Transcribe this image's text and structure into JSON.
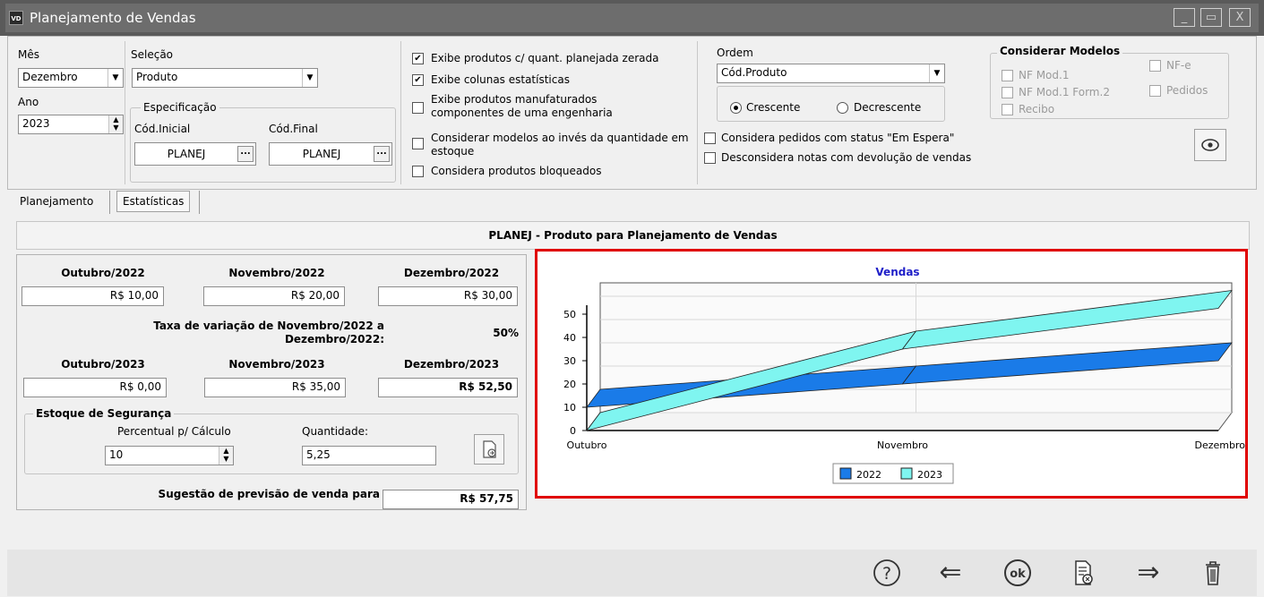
{
  "window": {
    "icon_text": "VD",
    "title": "Planejamento de Vendas",
    "minimize": "_",
    "maximize": "▭",
    "close": "X"
  },
  "filters": {
    "mes_label": "Mês",
    "mes_value": "Dezembro",
    "ano_label": "Ano",
    "ano_value": "2023",
    "selecao_label": "Seleção",
    "selecao_value": "Produto",
    "especificacao_label": "Especificação",
    "cod_inicial_label": "Cód.Inicial",
    "cod_inicial_value": "PLANEJ",
    "cod_final_label": "Cód.Final",
    "cod_final_value": "PLANEJ",
    "dots": "..."
  },
  "options": [
    {
      "label": "Exibe produtos c/ quant. planejada zerada",
      "checked": true
    },
    {
      "label": "Exibe colunas estatísticas",
      "checked": true
    },
    {
      "label": "Exibe produtos manufaturados componentes de uma engenharia",
      "checked": false
    },
    {
      "label": "Considerar modelos ao invés da quantidade em estoque",
      "checked": false
    },
    {
      "label": "Considera produtos bloqueados",
      "checked": false
    }
  ],
  "order": {
    "label": "Ordem",
    "value": "Cód.Produto",
    "asc": "Crescente",
    "desc": "Decrescente",
    "pedidos_espera": "Considera pedidos com status \"Em Espera\"",
    "devolucao": "Desconsidera notas com devolução de vendas"
  },
  "models": {
    "title": "Considerar Modelos",
    "nf_mod1": "NF Mod.1",
    "nf_mod1_form2": "NF Mod.1 Form.2",
    "recibo": "Recibo",
    "nfe": "NF-e",
    "pedidos": "Pedidos"
  },
  "tabs": {
    "planejamento": "Planejamento",
    "estatisticas": "Estatísticas"
  },
  "product_header": "PLANEJ - Produto para Planejamento de Vendas",
  "table": {
    "months_2022": [
      "Outubro/2022",
      "Novembro/2022",
      "Dezembro/2022"
    ],
    "values_2022": [
      "R$ 10,00",
      "R$ 20,00",
      "R$ 30,00"
    ],
    "taxa_label": "Taxa de variação de Novembro/2022 a Dezembro/2022:",
    "taxa_value": "50%",
    "months_2023": [
      "Outubro/2023",
      "Novembro/2023",
      "Dezembro/2023"
    ],
    "values_2023": [
      "R$ 0,00",
      "R$ 35,00",
      "R$ 52,50"
    ],
    "estoque_title": "Estoque de Segurança",
    "percentual_label": "Percentual p/ Cálculo",
    "percentual_value": "10",
    "quantidade_label": "Quantidade:",
    "quantidade_value": "5,25",
    "sugestao_label": "Sugestão de previsão de venda para",
    "sugestao_value": "R$ 57,75"
  },
  "chart_data": {
    "type": "line",
    "title": "Vendas",
    "categories": [
      "Outubro",
      "Novembro",
      "Dezembro"
    ],
    "series": [
      {
        "name": "2022",
        "values": [
          10,
          20,
          30
        ],
        "color": "#1a7be8"
      },
      {
        "name": "2023",
        "values": [
          0,
          35,
          52.5
        ],
        "color": "#7ff5f0"
      }
    ],
    "yticks": [
      "0",
      "10",
      "20",
      "30",
      "40",
      "50"
    ],
    "ylim": [
      0,
      50
    ],
    "grid": true,
    "legend": "bottom",
    "style": "3d-ribbon"
  },
  "footer": {
    "help": "?",
    "back": "⇐",
    "ok": "ok",
    "report": "▤",
    "forward": "⇒",
    "delete": "🗑"
  }
}
